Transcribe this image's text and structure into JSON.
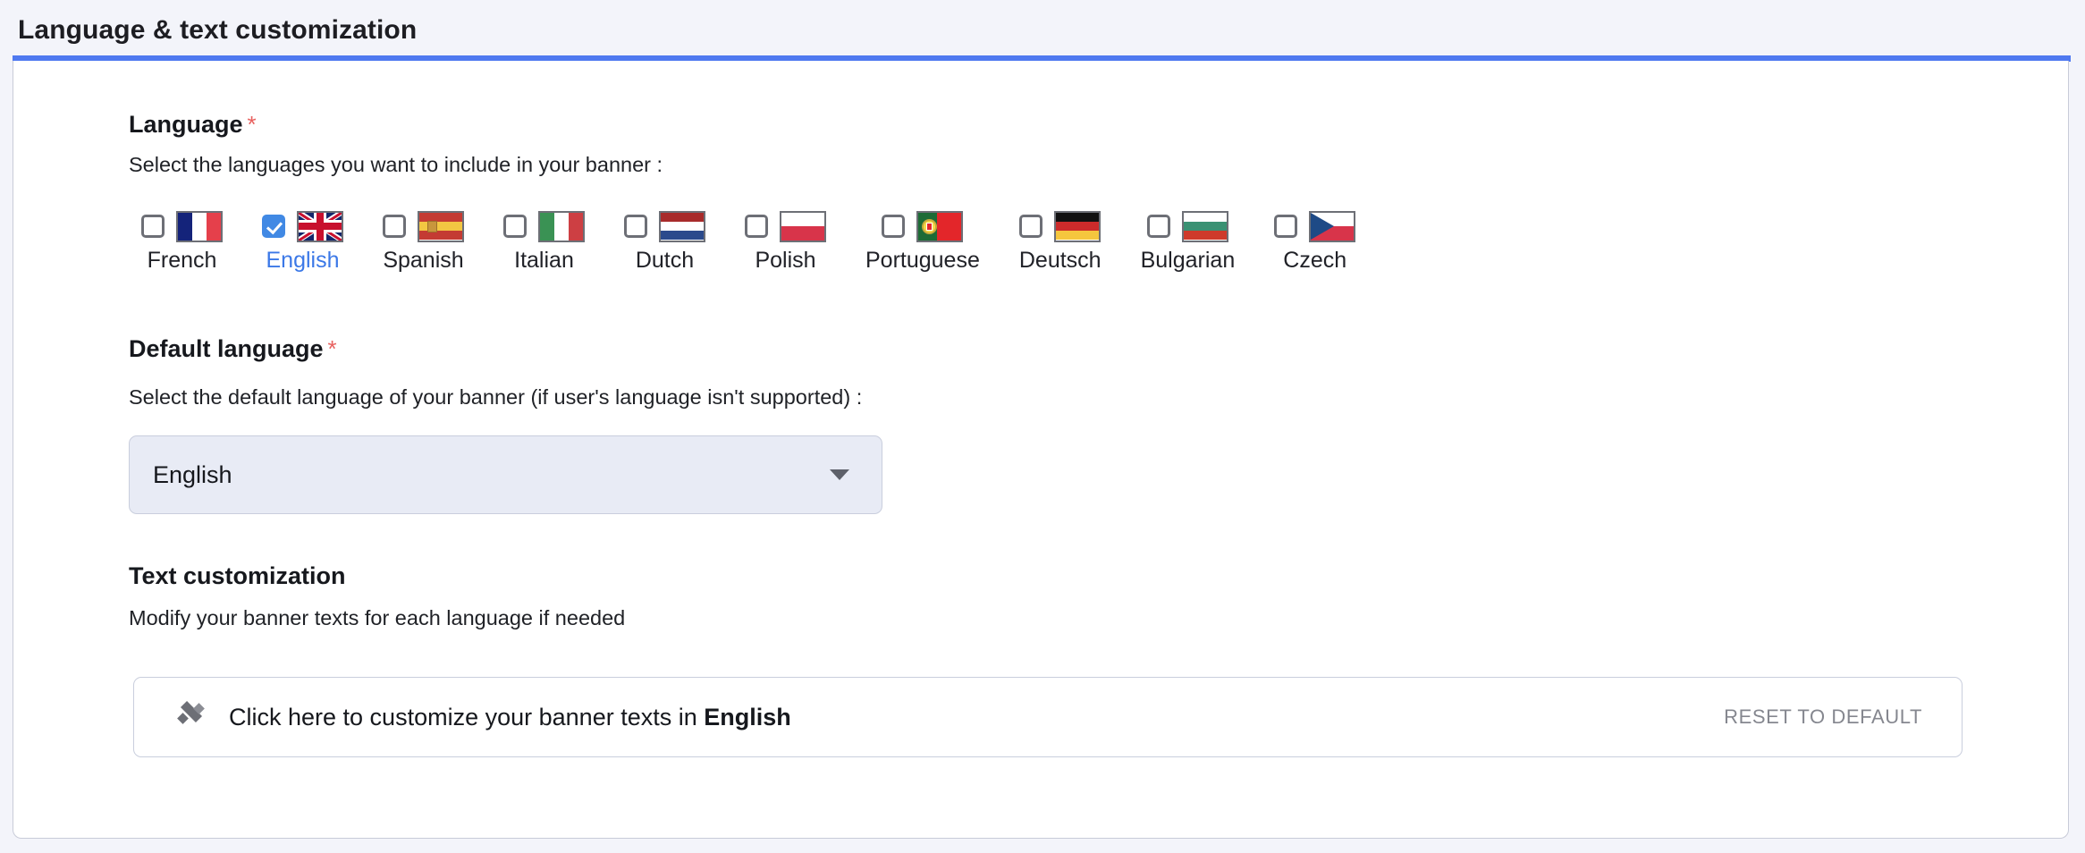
{
  "header": {
    "title": "Language & text customization",
    "accent_color": "#4f79f0",
    "background_color": "#f3f4fa"
  },
  "language_section": {
    "title": "Language",
    "required_marker": "*",
    "subtitle": "Select the languages you want to include in your banner :",
    "options": [
      {
        "label": "French",
        "flag": "flag-france",
        "checked": false
      },
      {
        "label": "English",
        "flag": "flag-united-kingdom",
        "checked": true
      },
      {
        "label": "Spanish",
        "flag": "flag-spain",
        "checked": false
      },
      {
        "label": "Italian",
        "flag": "flag-italy",
        "checked": false
      },
      {
        "label": "Dutch",
        "flag": "flag-netherlands",
        "checked": false
      },
      {
        "label": "Polish",
        "flag": "flag-poland",
        "checked": false
      },
      {
        "label": "Portuguese",
        "flag": "flag-portugal",
        "checked": false
      },
      {
        "label": "Deutsch",
        "flag": "flag-germany",
        "checked": false
      },
      {
        "label": "Bulgarian",
        "flag": "flag-bulgaria",
        "checked": false
      },
      {
        "label": "Czech",
        "flag": "flag-czech-republic",
        "checked": false
      }
    ],
    "selected_color": "#3b78e7",
    "checkbox_checked_color": "#4189e4"
  },
  "default_language_section": {
    "title": "Default language",
    "required_marker": "*",
    "subtitle": "Select the default language of your banner (if user's language isn't supported) :",
    "select": {
      "value": "English",
      "caret_icon": "chevron-down-icon"
    }
  },
  "text_customization_section": {
    "title": "Text customization",
    "subtitle": "Modify your banner texts for each language if needed",
    "customize_bar": {
      "icon": "pencil-icon",
      "text_prefix": "Click here to customize your banner texts in ",
      "text_language": "English",
      "reset_label": "RESET TO DEFAULT"
    }
  }
}
